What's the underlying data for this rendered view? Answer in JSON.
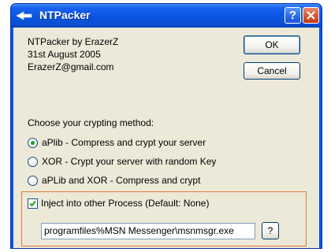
{
  "window": {
    "title": "NTPacker"
  },
  "info": {
    "line1": "NTPacker by ErazerZ",
    "line2": "31st August 2005",
    "line3": "ErazerZ@gmail.com"
  },
  "buttons": {
    "ok": "OK",
    "cancel": "Cancel",
    "browse": "?"
  },
  "crypt": {
    "label": "Choose your crypting method:",
    "options": [
      {
        "label": "aPlib - Compress and crypt your server",
        "selected": true
      },
      {
        "label": "XOR - Crypt your server with random Key",
        "selected": false
      },
      {
        "label": "aPLib and XOR - Compress and crypt",
        "selected": false
      }
    ]
  },
  "inject": {
    "label": "Inject into other Process (Default: None)",
    "checked": true,
    "path": "programfiles%MSN Messenger\\msnmsgr.exe"
  },
  "colors": {
    "titlebar": "#0a55e0",
    "dialog_bg": "#ece9d8",
    "highlight_box": "#e0783d",
    "radio_selected": "#21a121"
  }
}
